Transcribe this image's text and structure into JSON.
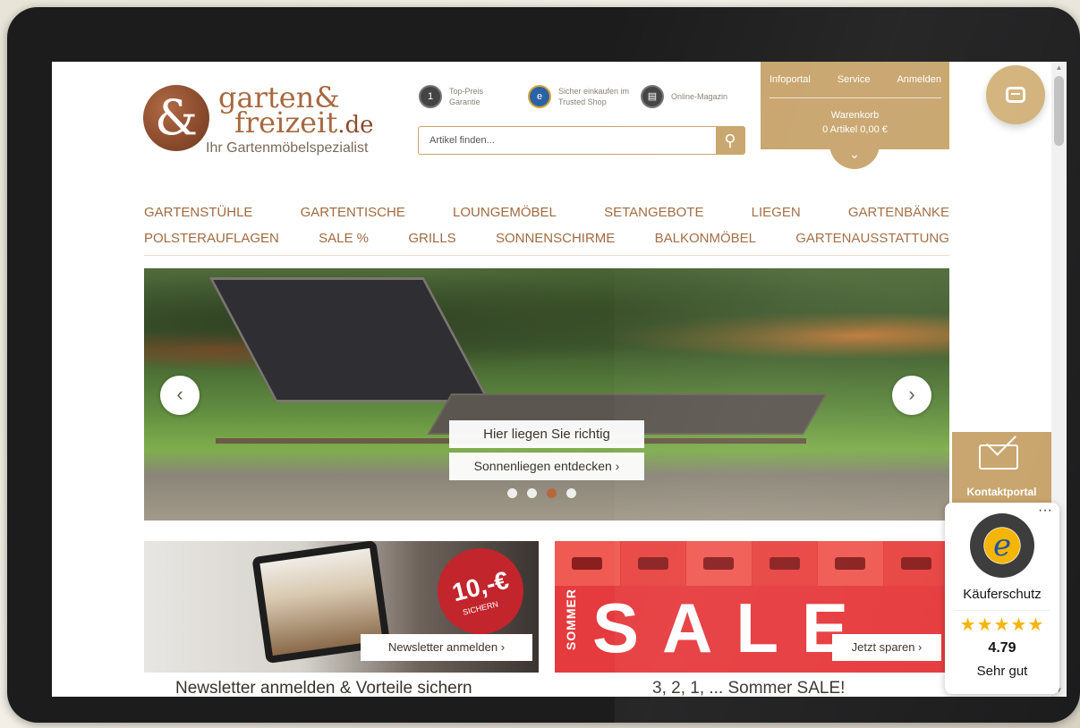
{
  "logo": {
    "line1": "garten&",
    "line2": "freizeit",
    "tld": ".de",
    "tagline": "Ihr Gartenmöbelspezialist"
  },
  "trust_badges": [
    {
      "icon": "medal-icon",
      "text_line1": "Top-Preis",
      "text_line2": "Garantie"
    },
    {
      "icon": "trusted-shops-icon",
      "text_line1": "Sicher einkaufen im",
      "text_line2": "Trusted Shop"
    },
    {
      "icon": "magazine-icon",
      "text_line1": "Online-Magazin",
      "text_line2": ""
    }
  ],
  "search": {
    "placeholder": "Artikel finden...",
    "icon": "search-icon"
  },
  "account": {
    "links": [
      "Infoportal",
      "Service",
      "Anmelden"
    ],
    "cart_label": "Warenkorb",
    "cart_value": "0 Artikel 0,00 €"
  },
  "nav": {
    "row1": [
      "GARTENSTÜHLE",
      "GARTENTISCHE",
      "LOUNGEMÖBEL",
      "SETANGEBOTE",
      "LIEGEN",
      "GARTENBÄNKE"
    ],
    "row2": [
      "POLSTERAUFLAGEN",
      "SALE %",
      "GRILLS",
      "SONNENSCHIRME",
      "BALKONMÖBEL",
      "GARTENAUSSTATTUNG"
    ]
  },
  "hero": {
    "caption_title": "Hier liegen Sie richtig",
    "caption_link": "Sonnenliegen entdecken  ›",
    "prev": "‹",
    "next": "›",
    "dots": 4,
    "active_dot": 3
  },
  "promos": {
    "left": {
      "badge_big": "10,-€",
      "badge_plus": "+",
      "badge_small": "SICHERN",
      "button": "Newsletter anmelden  ›",
      "caption": "Newsletter anmelden & Vorteile sichern"
    },
    "right": {
      "vertical_word": "SOMMER",
      "sale_word": "SALE",
      "button": "Jetzt sparen  ›",
      "caption": "3, 2, 1, ... Sommer SALE!"
    }
  },
  "contact": {
    "label": "Kontaktportal"
  },
  "trusted_shops": {
    "more": "···",
    "label": "Käuferschutz",
    "stars": "★★★★★",
    "score": "4.79",
    "rating_text": "Sehr gut"
  },
  "colors": {
    "brand_gold": "#c8a46c",
    "brand_brown": "#a06a40",
    "sale_red": "#e63b3e"
  }
}
